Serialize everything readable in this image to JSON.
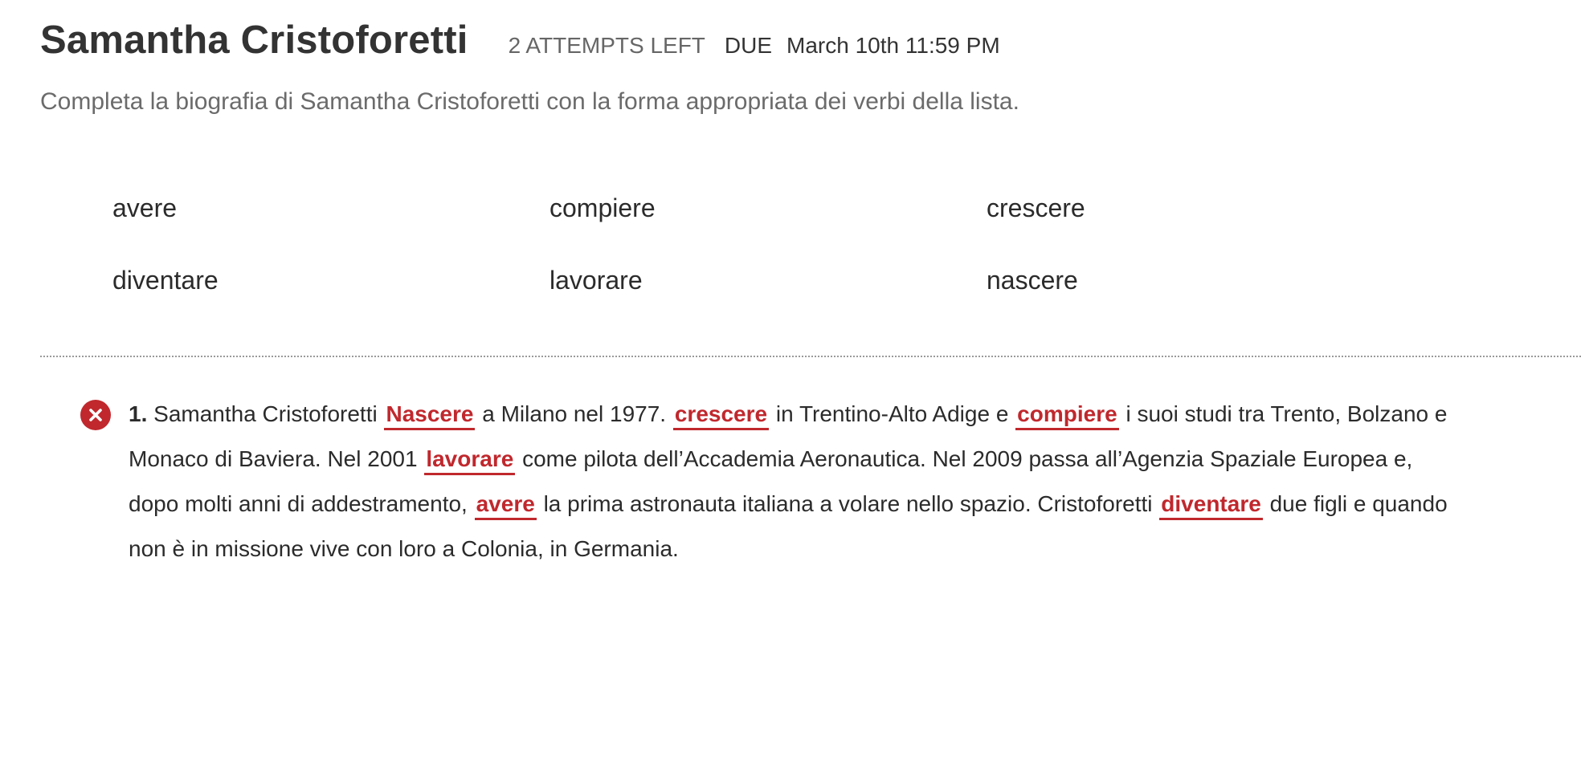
{
  "header": {
    "title": "Samantha Cristoforetti",
    "attempts": "2 ATTEMPTS LEFT",
    "due_label": "DUE",
    "due_date": "March 10th 11:59 PM"
  },
  "instructions": "Completa la biografia di Samantha Cristoforetti con la forma appropriata dei verbi della lista.",
  "word_bank": [
    "avere",
    "compiere",
    "crescere",
    "diventare",
    "lavorare",
    "nascere"
  ],
  "question": {
    "status": "incorrect",
    "status_icon": "x-circle-icon",
    "number": "1.",
    "segments": [
      " Samantha Cristoforetti ",
      " a Milano nel 1977. ",
      " in Trentino-Alto Adige e ",
      " i suoi studi tra Trento, Bolzano e Monaco di Baviera. Nel 2001 ",
      " come pilota dell’Accademia Aeronautica. Nel 2009 passa all’Agenzia Spaziale Europea e, dopo molti anni di addestramento, ",
      " la prima astronauta italiana a volare nello spazio. Cristoforetti ",
      " due figli e quando non è in missione vive con loro a Colonia, in Germania."
    ],
    "answers": [
      "Nascere",
      "crescere",
      "compiere",
      "lavorare",
      "avere",
      "diventare"
    ]
  },
  "colors": {
    "error": "#c0282d",
    "title": "#333333",
    "muted": "#666666"
  }
}
